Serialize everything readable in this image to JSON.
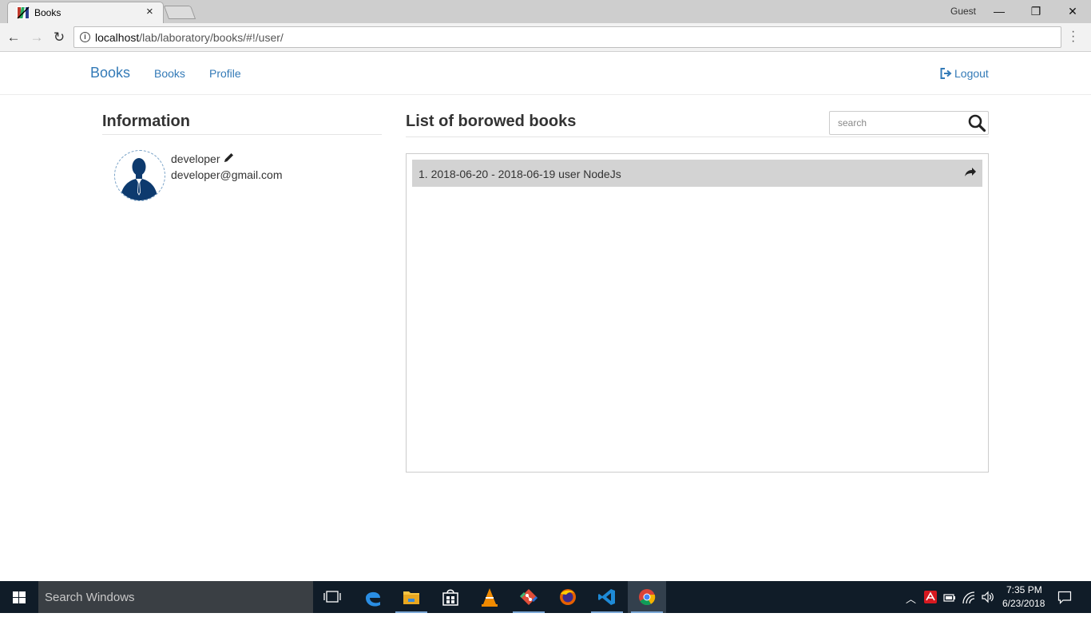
{
  "browser": {
    "tab_title": "Books",
    "tab_close": "×",
    "profile_label": "Guest",
    "url_host": "localhost",
    "url_path": "/lab/laboratory/books/#!/user/",
    "back_glyph": "←",
    "forward_glyph": "→",
    "reload_glyph": "↻",
    "minimize_glyph": "—",
    "maximize_glyph": "❐",
    "close_glyph": "✕"
  },
  "navbar": {
    "brand": "Books",
    "links": [
      "Books",
      "Profile"
    ],
    "logout": "Logout"
  },
  "info": {
    "heading": "Information",
    "username": "developer",
    "email": "developer@gmail.com",
    "avatar_icon": "user-silhouette-icon",
    "edit_icon": "pencil-icon"
  },
  "borrowed": {
    "heading": "List of borowed books",
    "search_placeholder": "search",
    "items": [
      {
        "text": "1. 2018-06-20 - 2018-06-19 user NodeJs",
        "action_icon": "share-arrow-icon"
      }
    ]
  },
  "taskbar": {
    "search_placeholder": "Search Windows",
    "time": "7:35 PM",
    "date": "6/23/2018",
    "pinned": [
      "task-view",
      "edge",
      "file-explorer",
      "store",
      "vlc",
      "git",
      "firefox",
      "vscode",
      "chrome"
    ]
  },
  "colors": {
    "link": "#337ab7",
    "taskbar": "#101c28",
    "row_bg": "#d3d3d3",
    "avatar_navy": "#0d3a6e"
  }
}
